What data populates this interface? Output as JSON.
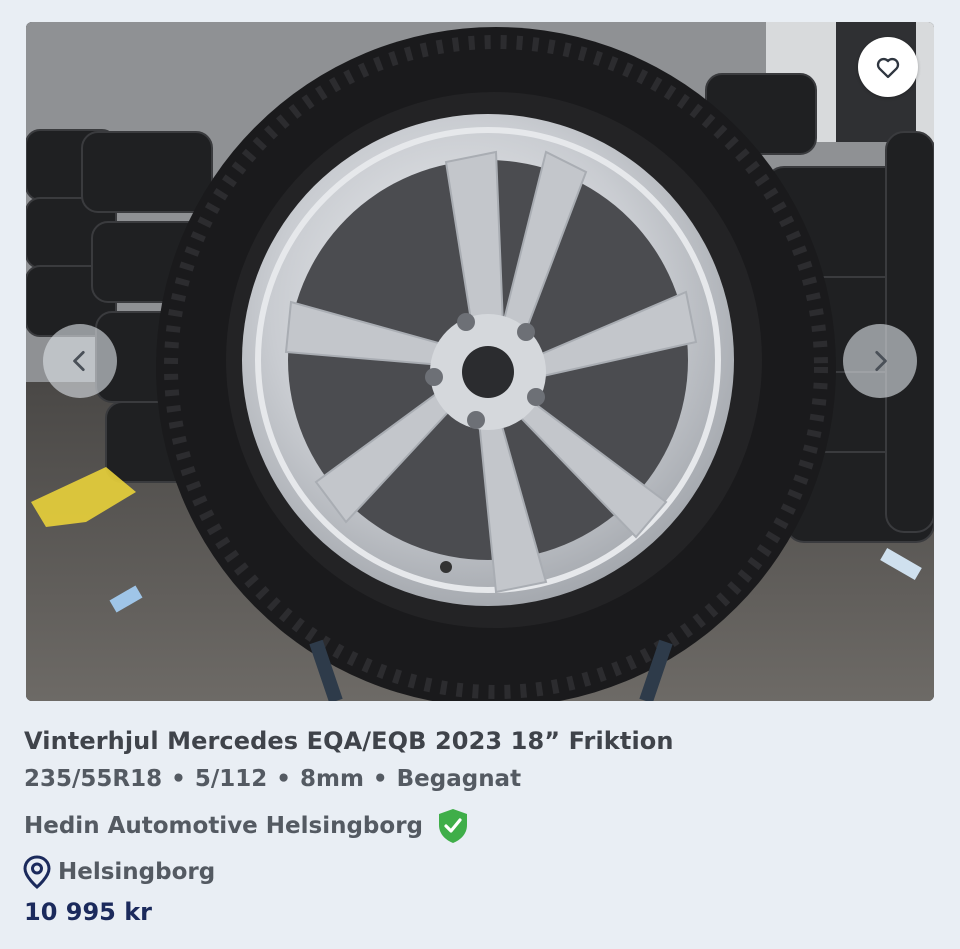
{
  "listing": {
    "title": "Vinterhjul Mercedes EQA/EQB 2023 18” Friktion",
    "specs": [
      "235/55R18",
      "5/112",
      "8mm",
      "Begagnat"
    ],
    "spec_separator": "•",
    "seller": "Hedin Automotive Helsingborg",
    "location": "Helsingborg",
    "price": "10 995 kr"
  },
  "icons": {
    "favorite": "heart-outline-icon",
    "previous": "chevron-left-icon",
    "next": "chevron-right-icon",
    "verified": "verified-shield-check-icon",
    "location": "map-pin-icon"
  },
  "colors": {
    "background": "#e9eef4",
    "price": "#1b2a5c",
    "verified_badge": "#3fae49",
    "location_pin": "#1b2a5c"
  }
}
